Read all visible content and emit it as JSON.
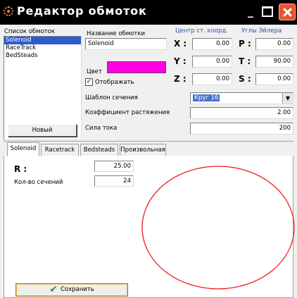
{
  "window": {
    "title": "Редактор обмоток"
  },
  "list": {
    "label": "Список обмоток",
    "items": [
      "Solenoid",
      "RaceTrack",
      "BedSteads"
    ],
    "selected_index": 0
  },
  "buttons": {
    "new": "Новый",
    "save": "Сохранить"
  },
  "form": {
    "name_label": "Название обмотки",
    "name_value": "Solenoid",
    "color_label": "Цвет",
    "color_value": "#ff00e6",
    "display_label": "Отображать",
    "display_checked": true,
    "template_label": "Шаблон сечения",
    "template_value": "Круг 16",
    "stretch_label": "Коэффициент растяжения",
    "stretch_value": "2.00",
    "current_label": "Сила тока",
    "current_value": "200"
  },
  "coords": {
    "header": "Центр ст. коорд.",
    "rows": [
      {
        "label": "X :",
        "value": "0.00"
      },
      {
        "label": "Y :",
        "value": "0.00"
      },
      {
        "label": "Z :",
        "value": "0.00"
      }
    ]
  },
  "euler": {
    "header": "Углы Эйлера",
    "rows": [
      {
        "label": "P :",
        "value": "0.00"
      },
      {
        "label": "T :",
        "value": "90.00"
      },
      {
        "label": "S :",
        "value": "0.00"
      }
    ]
  },
  "tabs": [
    "Solenoid",
    "Racetrack",
    "Bedsteads",
    "Произвольная"
  ],
  "active_tab": 0,
  "params": {
    "r_label": "R :",
    "r_value": "25.00",
    "sections_label": "Кол-во сечений",
    "sections_value": "24"
  },
  "preview": {
    "shape": "circle",
    "color": "#ee1c1c"
  },
  "colors": {
    "accent_blue": "#2b4fb8",
    "title_bar": "#000000",
    "close_button": "#e9542f"
  }
}
